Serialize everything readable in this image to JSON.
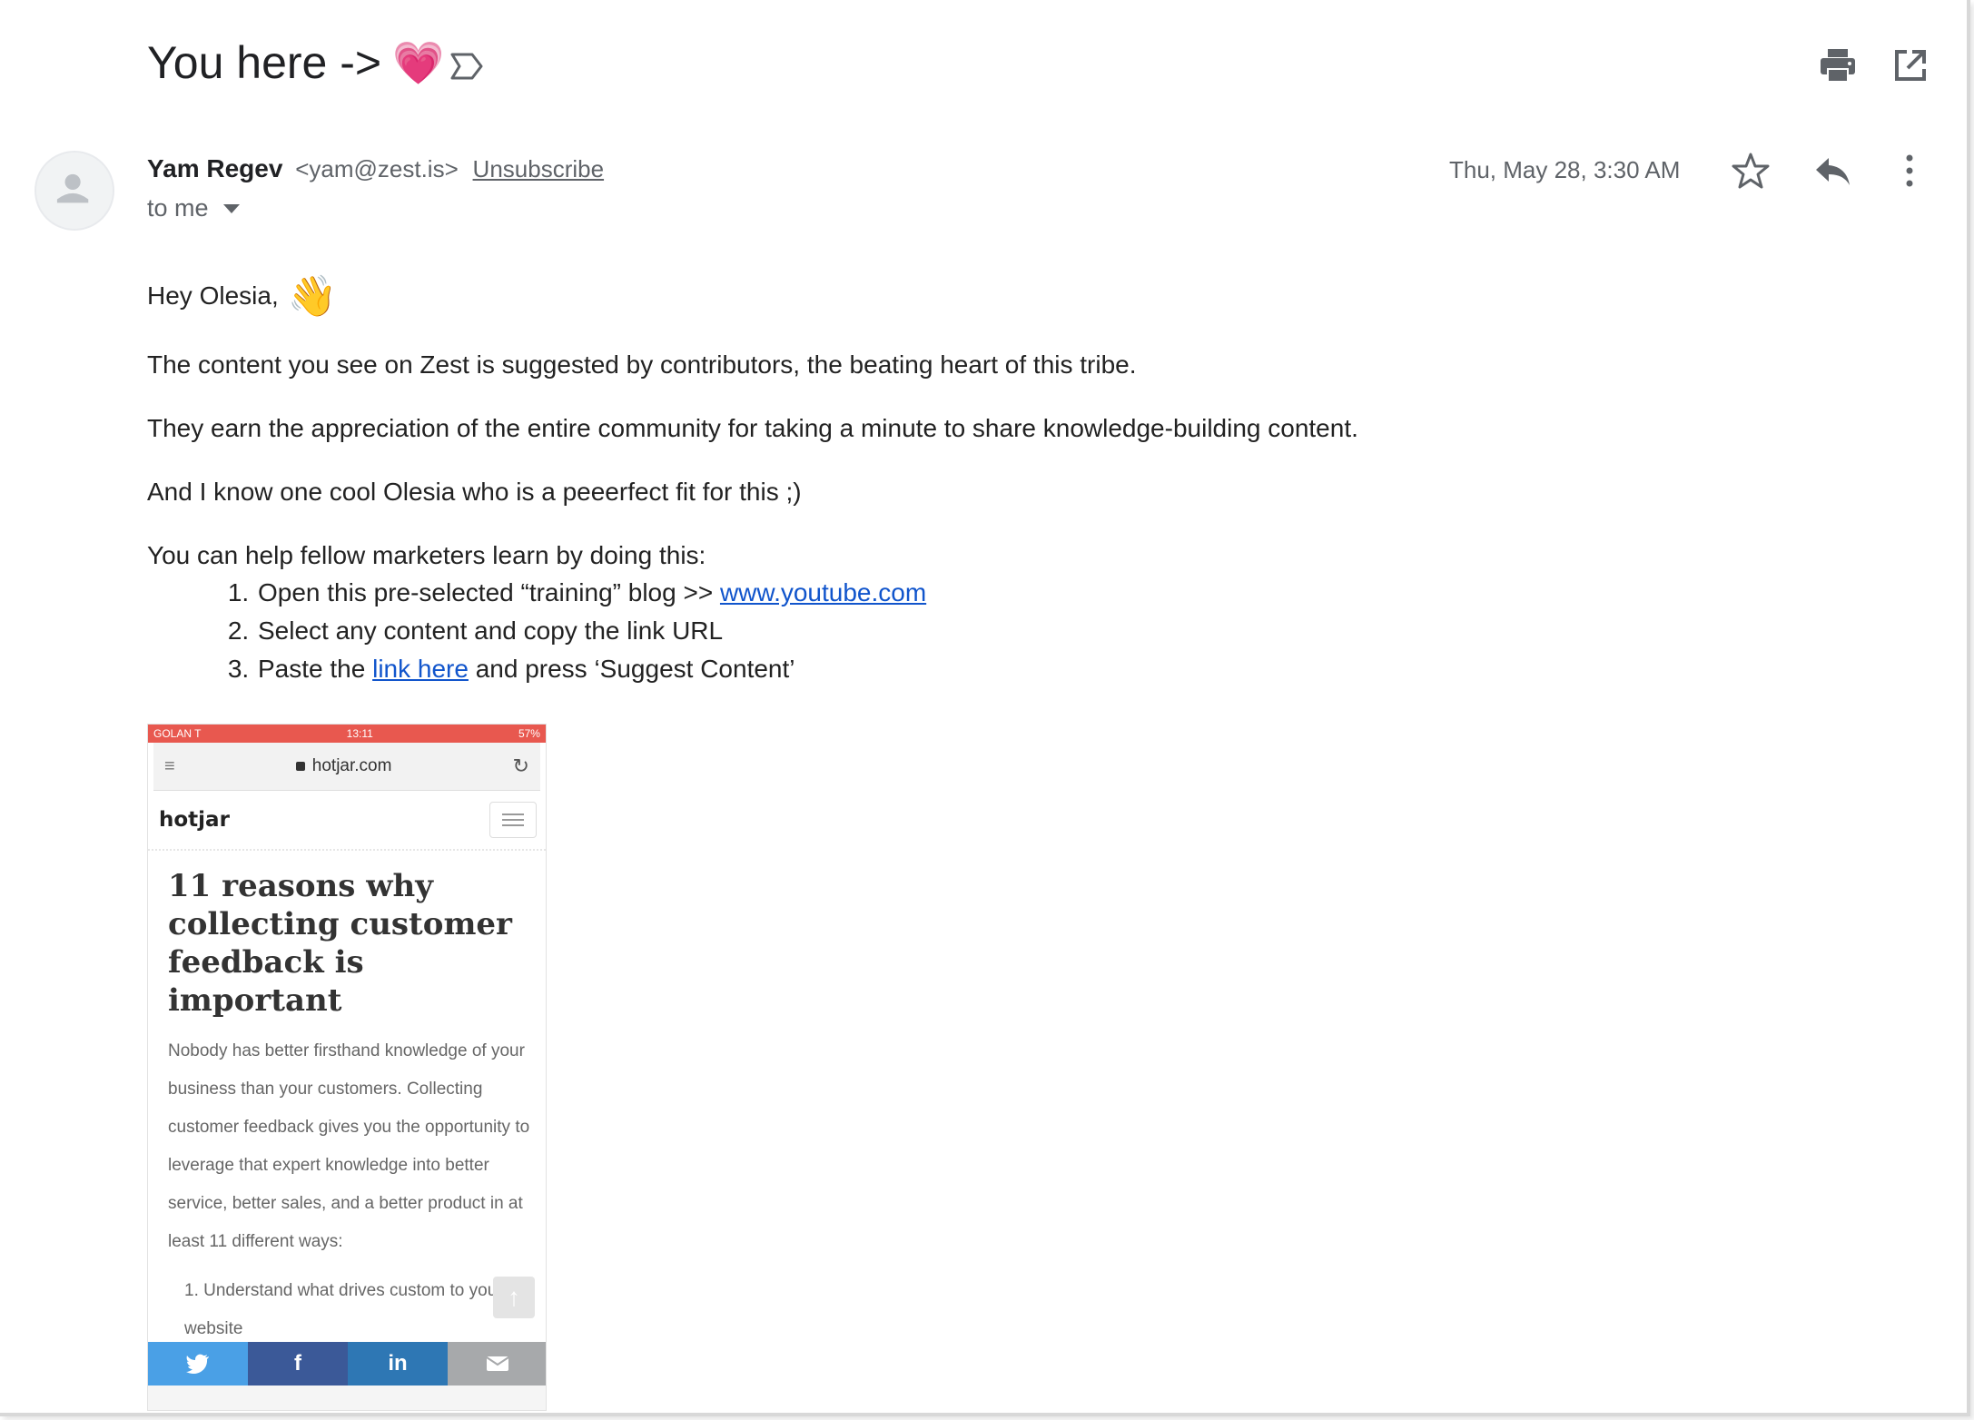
{
  "email": {
    "subject": "You here ->",
    "subject_emoji": "💗",
    "sender": {
      "name": "Yam Regev",
      "email": "<yam@zest.is>",
      "unsubscribe": "Unsubscribe"
    },
    "recipient": "to me",
    "date": "Thu, May 28, 3:30 AM",
    "body": {
      "greeting": "Hey Olesia,",
      "greeting_emoji": "👋",
      "paragraph_1": "The content you see on Zest is suggested by contributors, the beating heart of this tribe.",
      "paragraph_2": "They earn the appreciation of the entire community for taking a minute to share knowledge-building content.",
      "paragraph_3": "And I know one cool Olesia who is a peeerfect fit for this ;)",
      "paragraph_4": "You can help fellow marketers learn by doing this:",
      "steps": [
        {
          "before": "Open this pre-selected “training” blog >> ",
          "link": "www.youtube.com",
          "after": ""
        },
        {
          "before": "Select any content and copy the link URL",
          "link": "",
          "after": ""
        },
        {
          "before": "Paste the ",
          "link": "link here",
          "after": " and press ‘Suggest Content’"
        }
      ]
    }
  },
  "icons": {
    "label": "label-icon",
    "print": "print-icon",
    "new_window": "open-in-new-window-icon",
    "star": "star-icon",
    "reply": "reply-icon",
    "more": "more-vertical-icon",
    "avatar": "avatar-placeholder-icon"
  },
  "screenshot": {
    "status_carrier": "GOLAN T",
    "status_time": "13:11",
    "status_battery": "57%",
    "url": "hotjar.com",
    "logo": "hotjar",
    "title": "11 reasons why collecting customer feedback is important",
    "paragraph": "Nobody has better firsthand knowledge of your business than your customers. Collecting customer feedback gives you the opportunity to leverage that expert knowledge into better service, better sales, and a better product in at least 11 different ways:",
    "list_item": "1.  Understand what drives custom to your website"
  },
  "colors": {
    "link": "#1155cc",
    "status_bar": "#e8584f",
    "twitter": "#4aa0e6",
    "facebook": "#3b5998",
    "linkedin": "#2e77b4",
    "email_share": "#a7a9ab"
  }
}
